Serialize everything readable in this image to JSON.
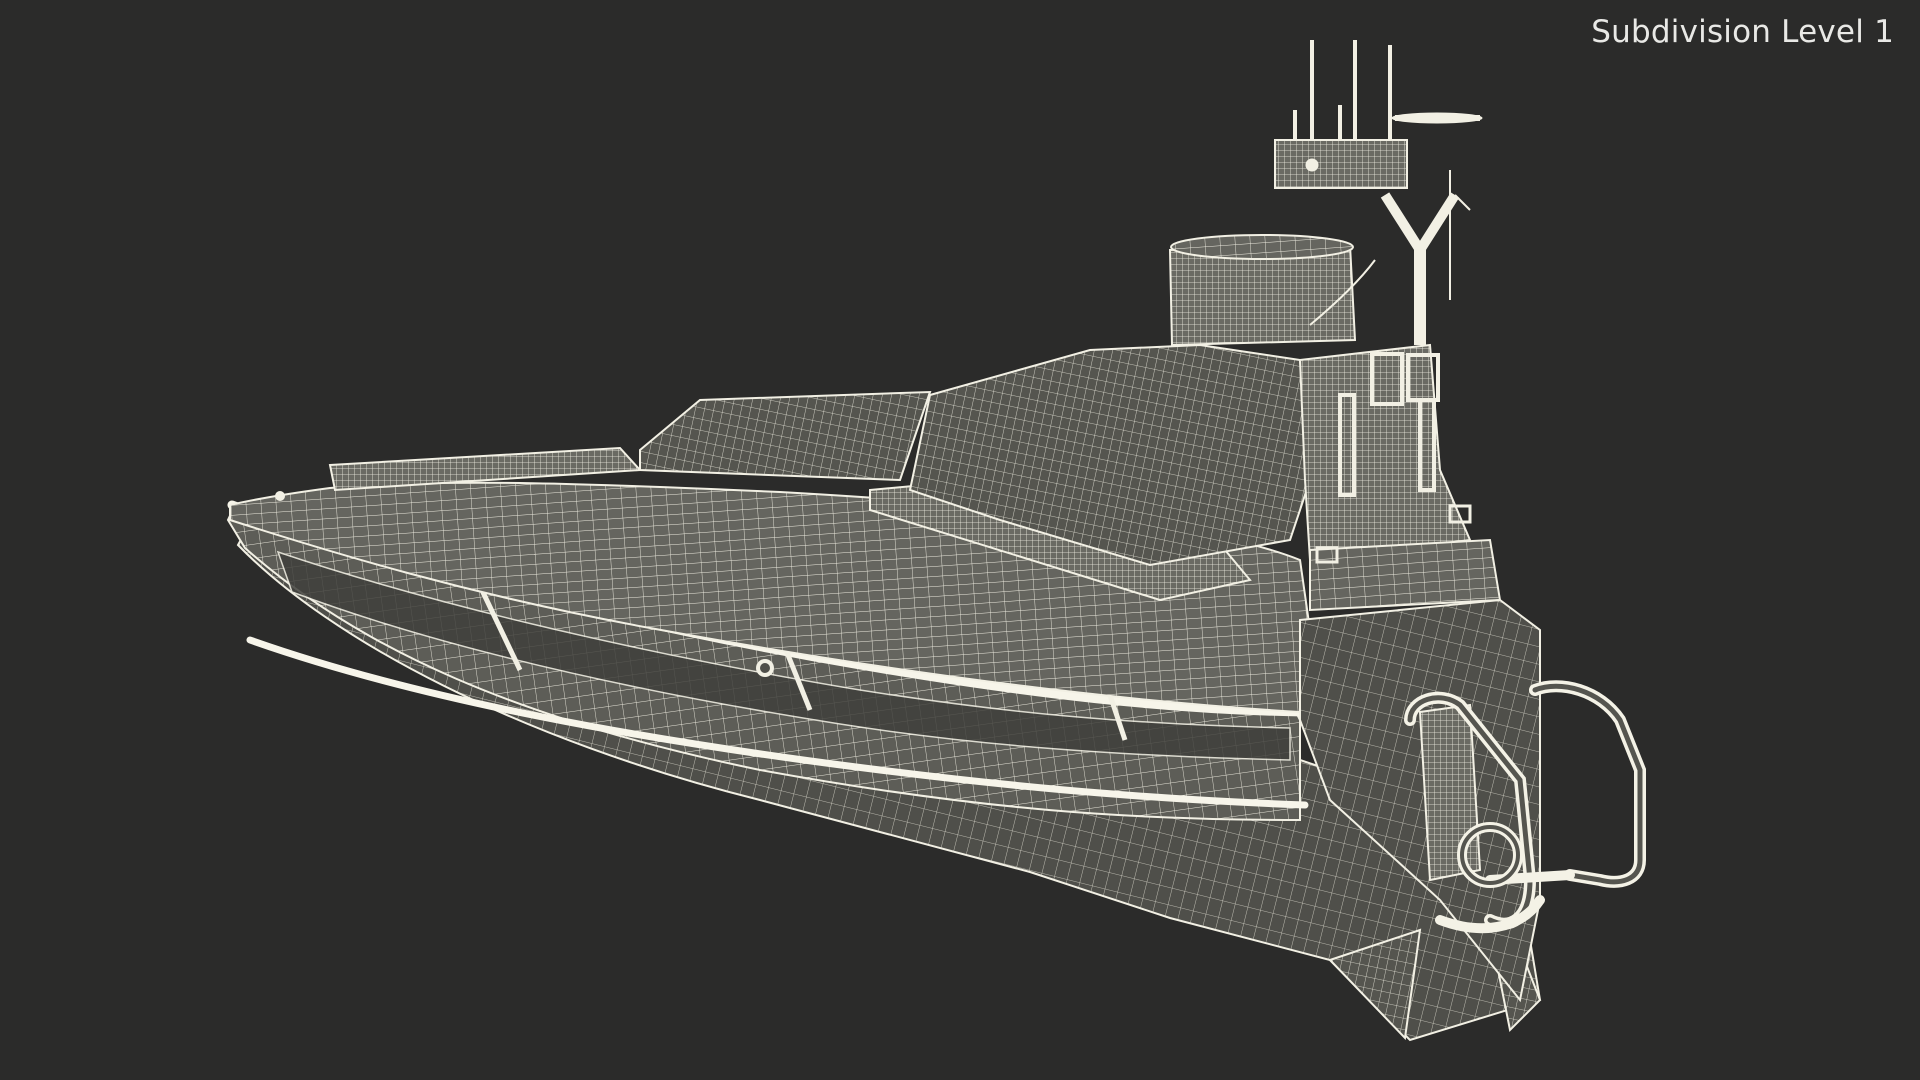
{
  "viewport": {
    "overlay_label": "Subdivision Level 1",
    "background_color": "#2b2b2a",
    "wire_color": "#f2f0e4",
    "surface_color": "#5d5d57"
  },
  "model": {
    "render_mode": "wireframe",
    "subject": "unmanned-surface-vessel"
  }
}
